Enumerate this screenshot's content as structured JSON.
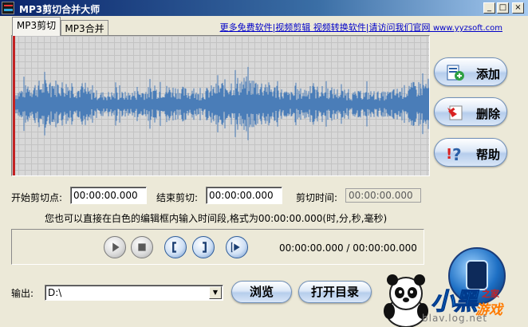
{
  "window": {
    "title": "MP3剪切合并大师",
    "app_icon_text": "MP3",
    "controls": {
      "minimize": "_",
      "maximize": "□",
      "close": "×"
    }
  },
  "tabs": [
    {
      "label": "MP3剪切",
      "active": true
    },
    {
      "label": "MP3合并",
      "active": false
    }
  ],
  "top_link": {
    "text": "更多免费软件|视频剪辑 视频转换软件|请访问我们官网 ",
    "url_text": "www.yyzsoft.com"
  },
  "waveform": {
    "color": "#4a7db8",
    "background": "#d8d8d8",
    "playhead_color": "#c32222"
  },
  "side_buttons": {
    "add": "添加",
    "delete": "删除",
    "help": "帮助"
  },
  "times": {
    "start_label": "开始剪切点:",
    "start_value": "00:00:00.000",
    "end_label": "结束剪切:",
    "end_value": "00:00:00.000",
    "duration_label": "剪切时间:",
    "duration_value": "00:00:00.000",
    "hint": "您也可以直接在白色的编辑框内输入时间段,格式为00:00:00.000(时,分,秒,毫秒)"
  },
  "player": {
    "buttons": [
      "play",
      "stop",
      "mark-start",
      "mark-end",
      "play-selection"
    ],
    "position": "00:00:00.000 / 00:00:00.000"
  },
  "output": {
    "label": "输出:",
    "path": "D:\\",
    "browse": "浏览",
    "open_dir": "打开目录"
  },
  "watermark": {
    "brand": "小黑",
    "sub": "游戏",
    "home": "之家",
    "url": "blav.log.net"
  }
}
